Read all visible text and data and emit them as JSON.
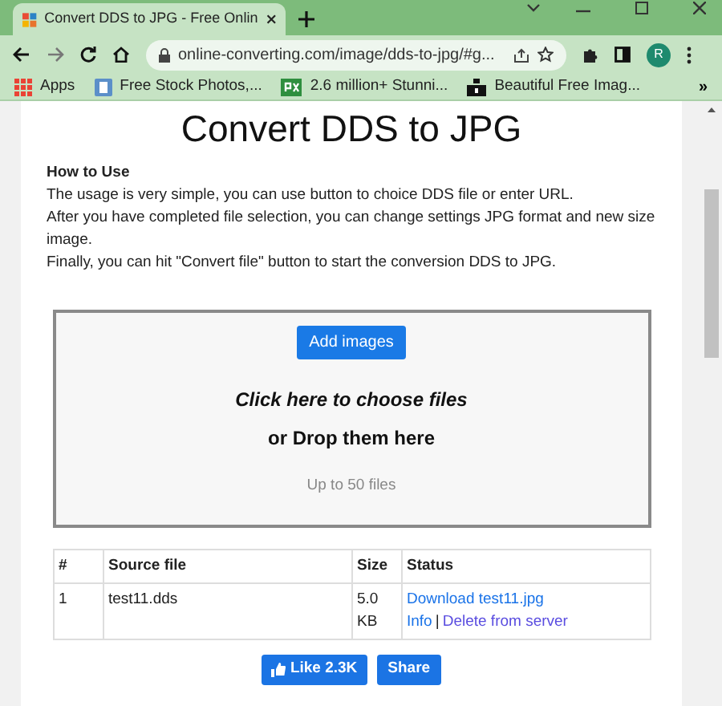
{
  "browser": {
    "tab": {
      "title": "Convert DDS to JPG - Free Onlin"
    },
    "url": "online-converting.com/image/dds-to-jpg/#g...",
    "profile": "R",
    "bookmarks": [
      {
        "label": "Apps",
        "kind": "apps"
      },
      {
        "label": "Free Stock Photos,...",
        "kind": "photo"
      },
      {
        "label": "2.6 million+ Stunni...",
        "kind": "px"
      },
      {
        "label": "Beautiful Free Imag...",
        "kind": "camera"
      }
    ],
    "more": "»"
  },
  "page": {
    "title": "Convert DDS to JPG",
    "how_to": {
      "heading": "How to Use",
      "lines": [
        "The usage is very simple, you can use button to choice DDS file or enter URL.",
        "After you have completed file selection, you can change settings JPG format and new size image.",
        "Finally, you can hit \"Convert file\" button to start the conversion DDS to JPG."
      ]
    },
    "drop_zone": {
      "button": "Add images",
      "choose": "Click here to choose files",
      "drop": "or Drop them here",
      "limit": "Up to 50 files"
    },
    "table": {
      "columns": [
        "#",
        "Source file",
        "Size",
        "Status"
      ],
      "rows": [
        {
          "index": "1",
          "file": "test11.dds",
          "size": "5.0 KB",
          "download": "Download test11.jpg",
          "info": "Info",
          "separator": "|",
          "delete": "Delete from server"
        }
      ]
    },
    "social": {
      "like": "Like 2.3K",
      "share": "Share"
    }
  }
}
